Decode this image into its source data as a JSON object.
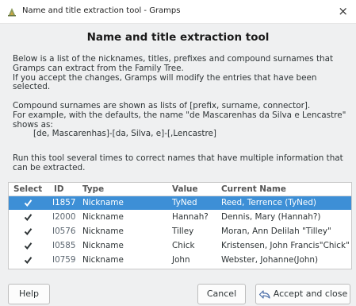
{
  "window": {
    "title": "Name and title extraction tool - Gramps",
    "close_glyph": "×"
  },
  "heading": "Name and title extraction tool",
  "intro": [
    "Below is a list of the nicknames, titles, prefixes and compound surnames that",
    "Gramps can extract from the Family Tree.",
    "If you accept the changes, Gramps will modify the entries that have been",
    "selected."
  ],
  "compound": [
    "Compound surnames are shown as lists of [prefix, surname, connector].",
    "For example, with the defaults, the name \"de Mascarenhas da Silva e Lencastre\"",
    "shows as:",
    "[de, Mascarenhas]-[da, Silva, e]-[,Lencastre]"
  ],
  "run_note": [
    "Run this tool several times to correct names that have multiple information that",
    "can be extracted."
  ],
  "table": {
    "headers": {
      "select": "Select",
      "id": "ID",
      "type": "Type",
      "value": "Value",
      "current": "Current Name"
    },
    "rows": [
      {
        "checked": true,
        "id": "I1857",
        "type": "Nickname",
        "value": "TyNed",
        "current": "Reed, Terrence (TyNed)",
        "selected": true
      },
      {
        "checked": true,
        "id": "I2000",
        "type": "Nickname",
        "value": "Hannah?",
        "current": "Dennis, Mary (Hannah?)",
        "selected": false
      },
      {
        "checked": true,
        "id": "I0576",
        "type": "Nickname",
        "value": "Tilley",
        "current": "Moran, Ann Delilah \"Tilley\"",
        "selected": false
      },
      {
        "checked": true,
        "id": "I0585",
        "type": "Nickname",
        "value": "Chick",
        "current": "Kristensen, John Francis\"Chick\"",
        "selected": false
      },
      {
        "checked": true,
        "id": "I0759",
        "type": "Nickname",
        "value": "John",
        "current": "Webster, Johanne(John)",
        "selected": false
      }
    ]
  },
  "buttons": {
    "help": "Help",
    "cancel": "Cancel",
    "accept": "Accept and close"
  },
  "colors": {
    "selection": "#3d8fd6",
    "background": "#eff0f1"
  }
}
